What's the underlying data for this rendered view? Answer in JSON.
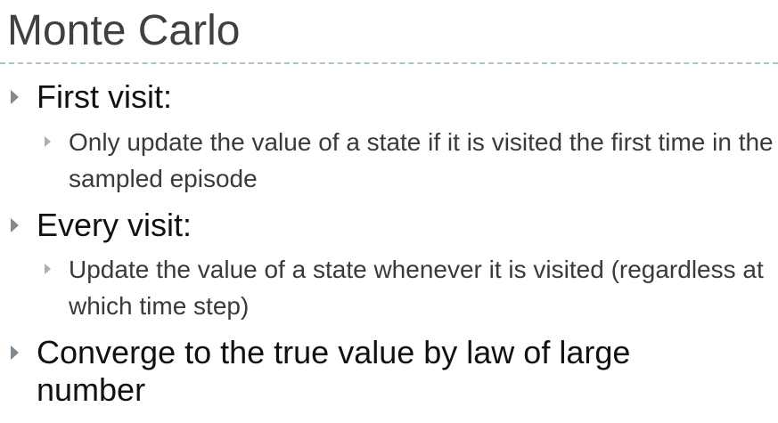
{
  "slide": {
    "title": "Monte Carlo",
    "bullets": [
      {
        "text": "First visit:"
      },
      {
        "text": "Only update the value of a state if it is visited the first time in the sampled episode"
      },
      {
        "text": "Every visit:"
      },
      {
        "text": "Update the value of a state whenever it is visited (regardless at which time step)"
      },
      {
        "text": "Converge to the true value by law of large number"
      }
    ]
  }
}
